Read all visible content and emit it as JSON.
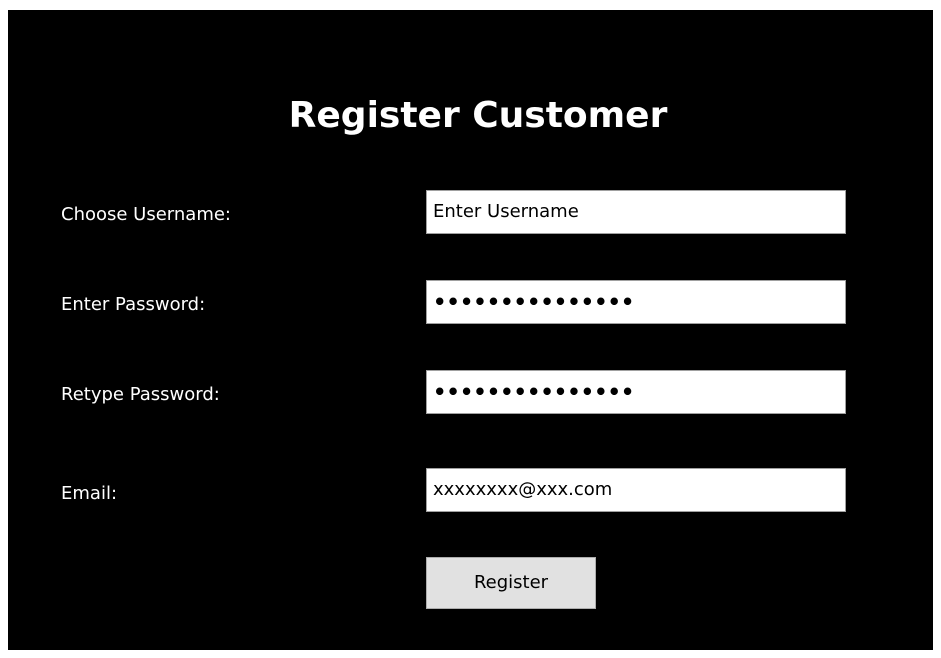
{
  "form": {
    "title": "Register Customer",
    "username_label": "Choose Username:",
    "username_value": "Enter Username",
    "password_label": "Enter Password:",
    "password_value": "•••••••••••••••",
    "retype_label": "Retype Password:",
    "retype_value": "•••••••••••••••",
    "email_label": "Email:",
    "email_value": "xxxxxxxx@xxx.com",
    "register_label": "Register"
  }
}
